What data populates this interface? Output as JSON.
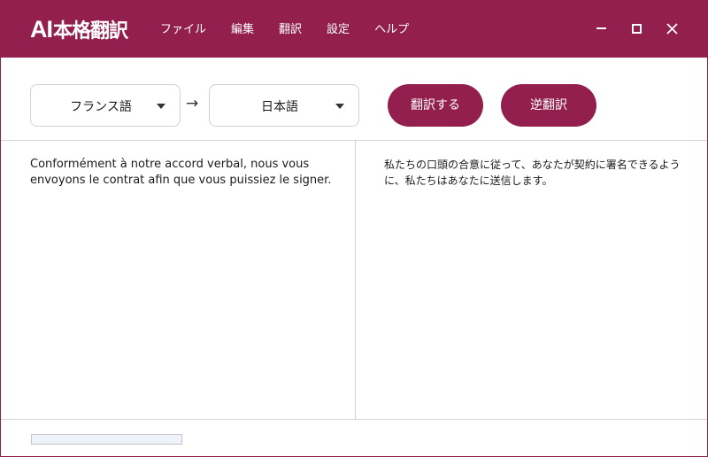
{
  "app": {
    "logo_ai": "AI",
    "logo_name": "本格翻訳"
  },
  "menu": {
    "items": [
      "ファイル",
      "編集",
      "翻訳",
      "設定",
      "ヘルプ"
    ]
  },
  "window_controls": {
    "minimize_icon": "minimize-icon",
    "maximize_icon": "maximize-icon",
    "close_symbol": "✕"
  },
  "toolbar": {
    "source_language": "フランス語",
    "target_language": "日本語",
    "direction_arrow": "→",
    "translate_label": "翻訳する",
    "reverse_label": "逆翻訳"
  },
  "panes": {
    "source_text": "Conformément à notre accord verbal, nous vous envoyons le contrat afin que vous puissiez le signer.",
    "target_text": "私たちの口頭の合意に従って、あなたが契約に署名できるように、私たちはあなたに送信します。"
  },
  "status": {
    "progress": 0
  },
  "colors": {
    "brand": "#921f4d",
    "border": "#d4d4d4"
  }
}
